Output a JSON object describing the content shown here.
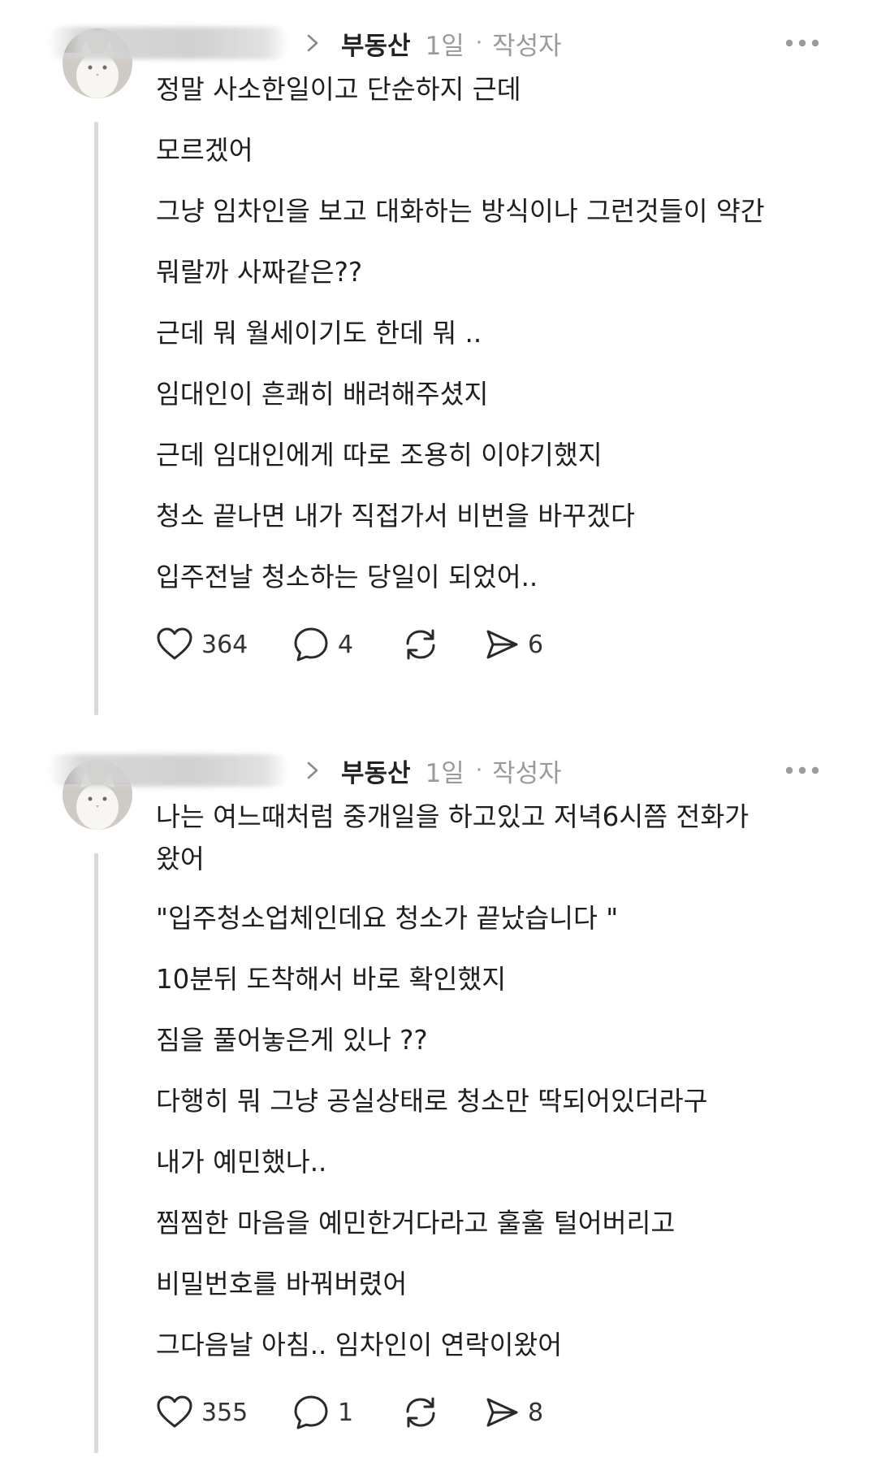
{
  "posts": [
    {
      "category": "부동산",
      "age": "1일",
      "separator": "·",
      "author_tag": "작성자",
      "lines": [
        "정말 사소한일이고 단순하지 근데",
        "모르겠어",
        "그냥 임차인을 보고 대화하는 방식이나 그런것들이 약간",
        "뭐랄까 사짜같은??",
        "근데 뭐 월세이기도 한데 뭐 ..",
        "임대인이 흔쾌히 배려해주셨지",
        "근데 임대인에게 따로 조용히 이야기했지",
        "청소 끝나면 내가 직접가서 비번을 바꾸겠다",
        "입주전날 청소하는 당일이 되었어.."
      ],
      "likes": "364",
      "comments": "4",
      "shares": "6"
    },
    {
      "category": "부동산",
      "age": "1일",
      "separator": "·",
      "author_tag": "작성자",
      "lines": [
        "나는 여느때처럼 중개일을 하고있고 저녁6시쯤 전화가",
        "왔어",
        "\"입주청소업체인데요 청소가 끝났습니다 \"",
        "10분뒤 도착해서 바로 확인했지",
        "짐을 풀어놓은게 있나 ??",
        "다행히 뭐 그냥 공실상태로 청소만 딱되어있더라구",
        "내가 예민했나..",
        "찜찜한 마음을 예민한거다라고 훌훌 털어버리고",
        "비밀번호를 바꿔버렸어",
        "그다음날 아침.. 임차인이 연락이왔어"
      ],
      "likes": "355",
      "comments": "1",
      "shares": "8"
    }
  ],
  "icons": {
    "avatar": "white-cat-photo",
    "chevron": "chevron-right-icon",
    "more": "more-dots-icon",
    "like": "heart-icon",
    "comment": "speech-bubble-icon",
    "repost": "repost-icon",
    "share": "send-icon"
  },
  "colors": {
    "text": "#1e1e1e",
    "muted": "#9a9a9a",
    "thread_line": "#d9d9d9"
  }
}
